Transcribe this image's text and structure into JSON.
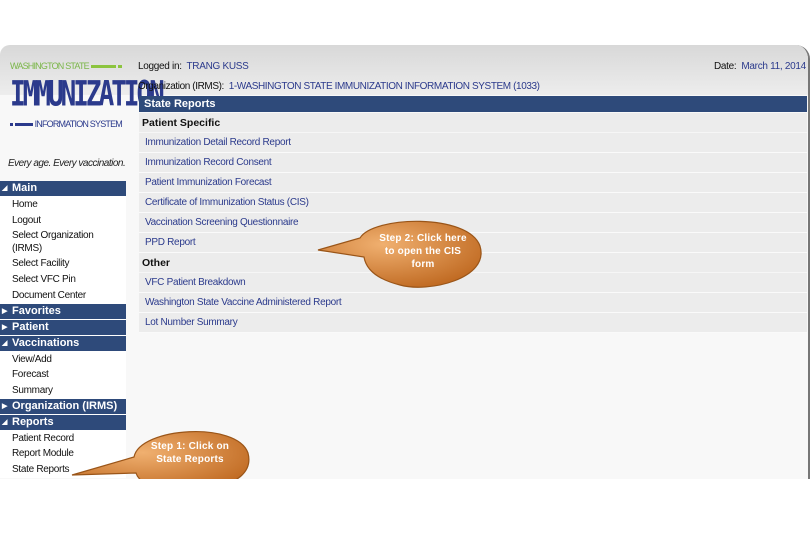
{
  "logo": {
    "top_text": "WASHINGTON STATE",
    "main_text": "IMMUNIZATION",
    "bottom_text": "INFORMATION SYSTEM",
    "tagline": "Every age. Every vaccination."
  },
  "header": {
    "logged_in_label": "Logged in:",
    "logged_in_value": "TRANG KUSS",
    "date_label": "Date:",
    "date_value": "March 11, 2014",
    "org_label": "Organization (IRMS):",
    "org_value": "1-WASHINGTON STATE IMMUNIZATION INFORMATION SYSTEM (1033)"
  },
  "sidebar": {
    "sections": [
      {
        "label": "Main",
        "expanded": true,
        "items": [
          "Home",
          "Logout",
          "Select Organization (IRMS)",
          "Select Facility",
          "Select VFC Pin",
          "Document Center"
        ]
      },
      {
        "label": "Favorites",
        "expanded": false,
        "items": []
      },
      {
        "label": "Patient",
        "expanded": false,
        "items": []
      },
      {
        "label": "Vaccinations",
        "expanded": true,
        "items": [
          "View/Add",
          "Forecast",
          "Summary"
        ]
      },
      {
        "label": "Organization (IRMS)",
        "expanded": false,
        "items": []
      },
      {
        "label": "Reports",
        "expanded": true,
        "items": [
          "Patient Record",
          "Report Module",
          "State Reports"
        ]
      }
    ]
  },
  "page": {
    "title": "State Reports",
    "groups": [
      {
        "label": "Patient Specific",
        "reports": [
          "Immunization Detail Record Report",
          "Immunization Record Consent",
          "Patient Immunization Forecast",
          "Certificate of Immunization Status (CIS)",
          "Vaccination Screening Questionnaire",
          "PPD Report"
        ]
      },
      {
        "label": "Other",
        "reports": [
          "VFC Patient Breakdown",
          "Washington State Vaccine Administered Report",
          "Lot Number Summary"
        ]
      }
    ]
  },
  "callouts": {
    "step1": "Step 1: Click on State Reports",
    "step2": "Step 2:  Click here to open the CIS form",
    "color": "#d4823a"
  },
  "colors": {
    "nav_header": "#2e4a7a",
    "link": "#2b3a8c",
    "logo_green": "#8cc43f",
    "logo_blue": "#2b3a8c"
  }
}
